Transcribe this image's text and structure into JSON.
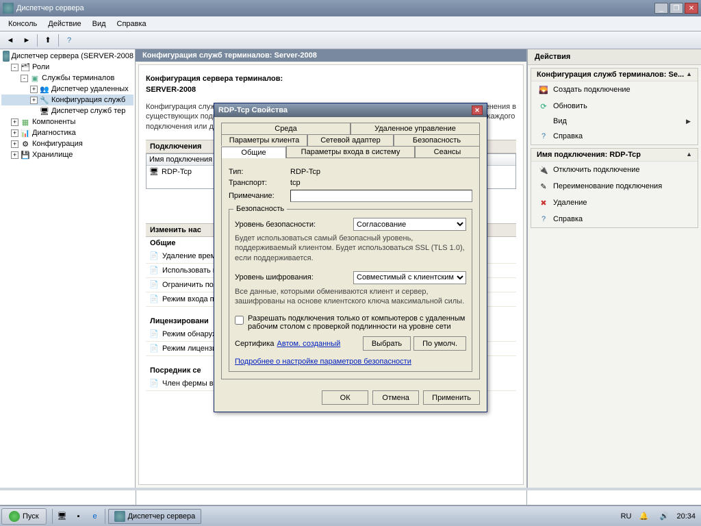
{
  "window": {
    "title": "Диспетчер сервера"
  },
  "menu": {
    "console": "Консоль",
    "action": "Действие",
    "view": "Вид",
    "help": "Справка"
  },
  "tree": {
    "root": "Диспетчер сервера (SERVER-2008",
    "roles": "Роли",
    "ts": "Службы терминалов",
    "rd": "Диспетчер удаленных",
    "tscfg": "Конфигурация служб",
    "tsrv": "Диспетчер служб тер",
    "components": "Компоненты",
    "diag": "Диагностика",
    "config": "Конфигурация",
    "storage": "Хранилище"
  },
  "center": {
    "header": "Конфигурация служб терминалов: Server-2008",
    "title": "Конфигурация сервера терминалов:",
    "server": "SERVER-2008",
    "desc_left": "Конфигурация служб",
    "desc_mid": "существующих подк",
    "desc_right1": "зменения в",
    "desc_right2": "ля каждого",
    "desc_bottom": "подключения или дл",
    "sec_connections": "Подключения",
    "col_name": "Имя подключения",
    "row_conn": "RDP-Tcp",
    "sec_edit_prefix": "Изменить нас",
    "sec_general": "Общие",
    "ed_items": [
      "Удаление времен",
      "Использовать вр",
      "Ограничить пол",
      "Режим входа по"
    ],
    "sec_licensing": "Лицензировани",
    "lic_items": [
      "Режим обнаруж",
      "Режим лицензи"
    ],
    "sec_broker": "Посредник се",
    "broker_item": "Член фермы в п"
  },
  "actions": {
    "header": "Действия",
    "g1": "Конфигурация служб терминалов: Se...",
    "g1_items": {
      "create": "Создать подключение",
      "refresh": "Обновить",
      "view": "Вид",
      "help": "Справка"
    },
    "g2": "Имя подключения: RDP-Tcp",
    "g2_items": {
      "disable": "Отключить подключение",
      "rename": "Переименование подключения",
      "delete": "Удаление",
      "help": "Справка"
    }
  },
  "dialog": {
    "title": "RDP-Tcp Свойства",
    "tabs_row1": {
      "env": "Среда",
      "remote": "Удаленное управление"
    },
    "tabs_row2": {
      "client": "Параметры клиента",
      "adapter": "Сетевой адаптер",
      "security": "Безопасность"
    },
    "tabs_row3": {
      "general": "Общие",
      "logon": "Параметры входа в систему",
      "sessions": "Сеансы"
    },
    "type_lbl": "Тип:",
    "type_val": "RDP-Tcp",
    "trans_lbl": "Транспорт:",
    "trans_val": "tcp",
    "note_lbl": "Примечание:",
    "note_val": "",
    "sec_group": "Безопасность",
    "sec_level_lbl": "Уровень безопасности:",
    "sec_level_options": [
      "Согласование"
    ],
    "sec_desc": "Будет использоваться самый безопасный уровень, поддерживаемый клиентом. Будет использоваться SSL (TLS 1.0), если поддерживается.",
    "enc_lbl": "Уровень шифрования:",
    "enc_options": [
      "Совместимый с клиентским"
    ],
    "enc_desc": "Все данные, которыми обмениваются клиент и сервер, зашифрованы на основе клиентского ключа максимальной силы.",
    "nla_chk": "Разрешать подключения только от компьютеров с удаленным рабочим столом с проверкой подлинности на уровне сети",
    "cert_lbl": "Сертифика",
    "cert_link": "Автом. созданный",
    "btn_select": "Выбрать",
    "btn_default": "По умолч.",
    "more_link": "Подробнее о настройке параметров безопасности",
    "btn_ok": "ОК",
    "btn_cancel": "Отмена",
    "btn_apply": "Применить"
  },
  "taskbar": {
    "start": "Пуск",
    "task": "Диспетчер сервера",
    "lang": "RU",
    "time": "20:34"
  }
}
